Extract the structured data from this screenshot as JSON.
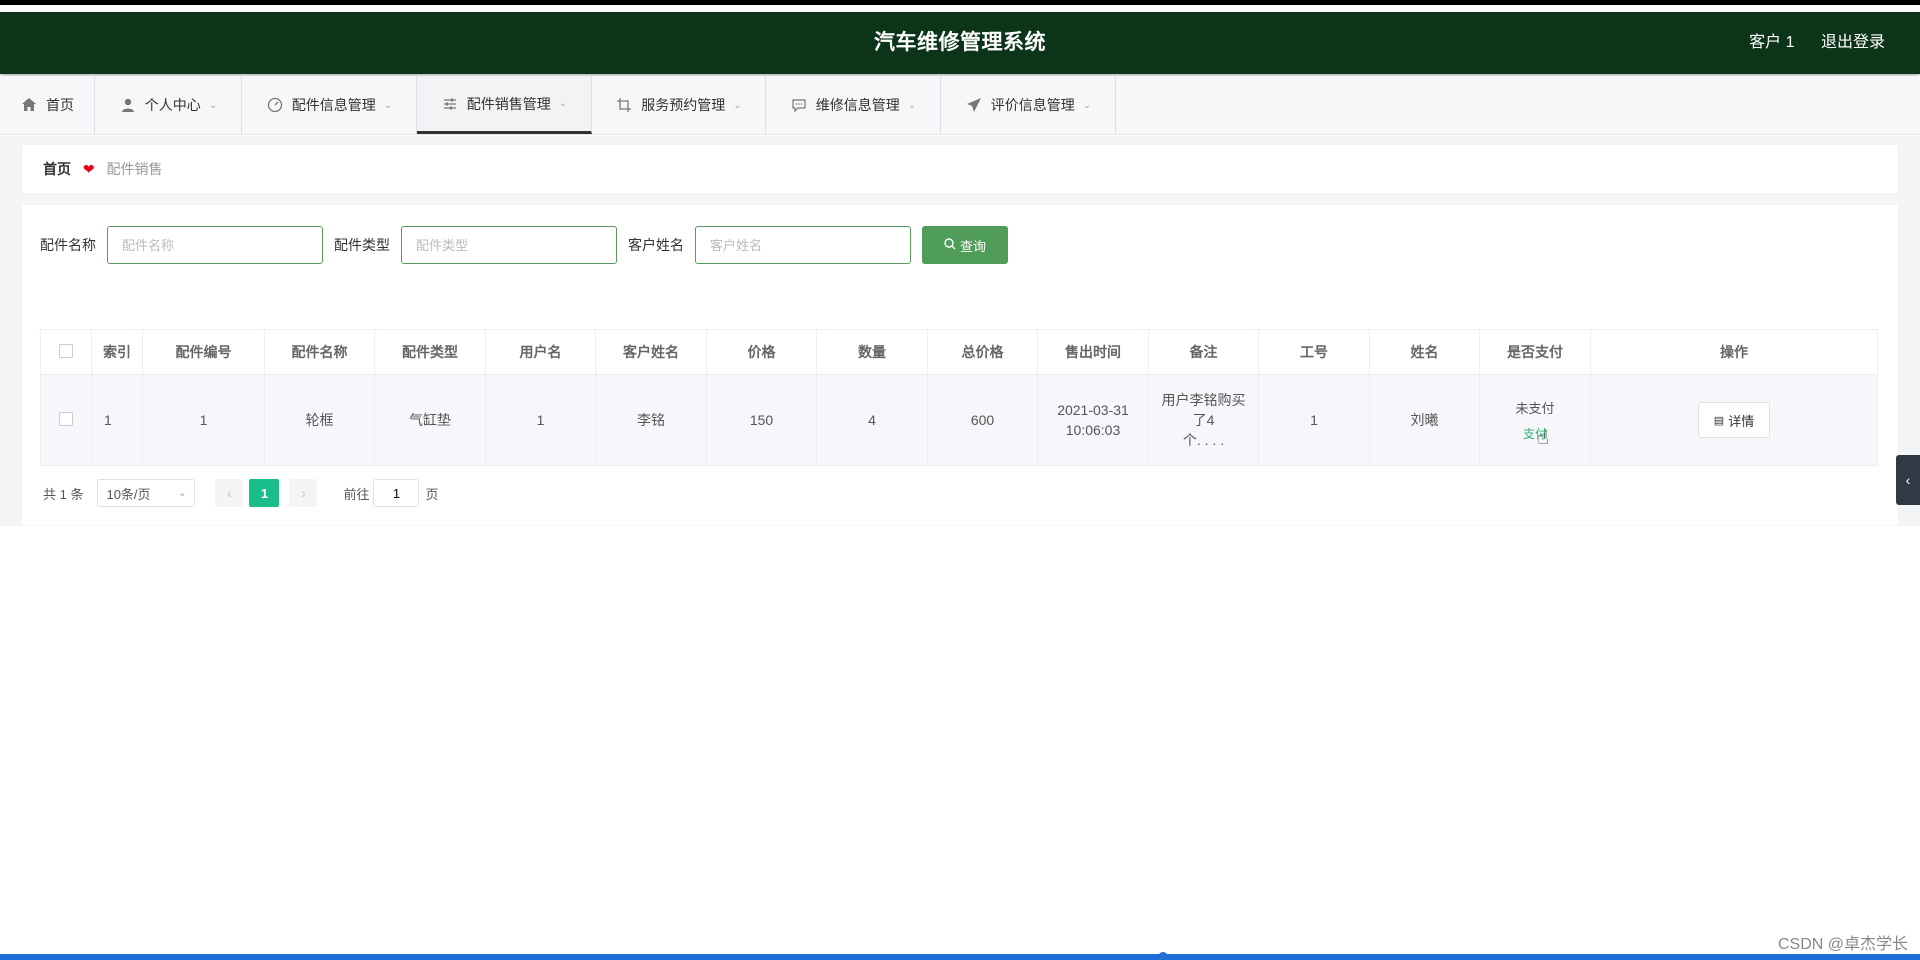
{
  "header": {
    "title": "汽车维修管理系统",
    "user": "客户 1",
    "logout": "退出登录",
    "bg_color": "#0c3419"
  },
  "nav": {
    "items": [
      {
        "label": "首页",
        "icon": "home-icon"
      },
      {
        "label": "个人中心",
        "icon": "user-icon"
      },
      {
        "label": "配件信息管理",
        "icon": "gauge-icon"
      },
      {
        "label": "配件销售管理",
        "icon": "sliders-icon",
        "active": true
      },
      {
        "label": "服务预约管理",
        "icon": "crop-icon"
      },
      {
        "label": "维修信息管理",
        "icon": "chat-icon"
      },
      {
        "label": "评价信息管理",
        "icon": "send-icon"
      }
    ]
  },
  "breadcrumb": {
    "home": "首页",
    "current": "配件销售"
  },
  "search": {
    "name_label": "配件名称",
    "name_placeholder": "配件名称",
    "type_label": "配件类型",
    "type_placeholder": "配件类型",
    "customer_label": "客户姓名",
    "customer_placeholder": "客户姓名",
    "query_button": "查询"
  },
  "table": {
    "headers": [
      "索引",
      "配件编号",
      "配件名称",
      "配件类型",
      "用户名",
      "客户姓名",
      "价格",
      "数量",
      "总价格",
      "售出时间",
      "备注",
      "工号",
      "姓名",
      "是否支付",
      "操作"
    ],
    "rows": [
      {
        "index": "1",
        "part_no": "1",
        "part_name": "轮框",
        "part_type": "气缸垫",
        "username": "1",
        "customer_name": "李铭",
        "price": "150",
        "quantity": "4",
        "total": "600",
        "sold_date": "2021-03-31",
        "sold_time": "10:06:03",
        "remark_line1": "用户李铭购买",
        "remark_line2": "了4",
        "remark_line3": "个. . . .",
        "staff_no": "1",
        "staff_name": "刘曦",
        "paid_status": "未支付",
        "pay_action": "支付",
        "detail_button": "详情"
      }
    ]
  },
  "pager": {
    "total": "共 1 条",
    "page_size": "10条/页",
    "current_page": "1",
    "goto_label": "前往",
    "goto_value": "1",
    "page_unit": "页"
  },
  "watermark": "CSDN @卓杰学长",
  "accent_color": "#19bd8a"
}
